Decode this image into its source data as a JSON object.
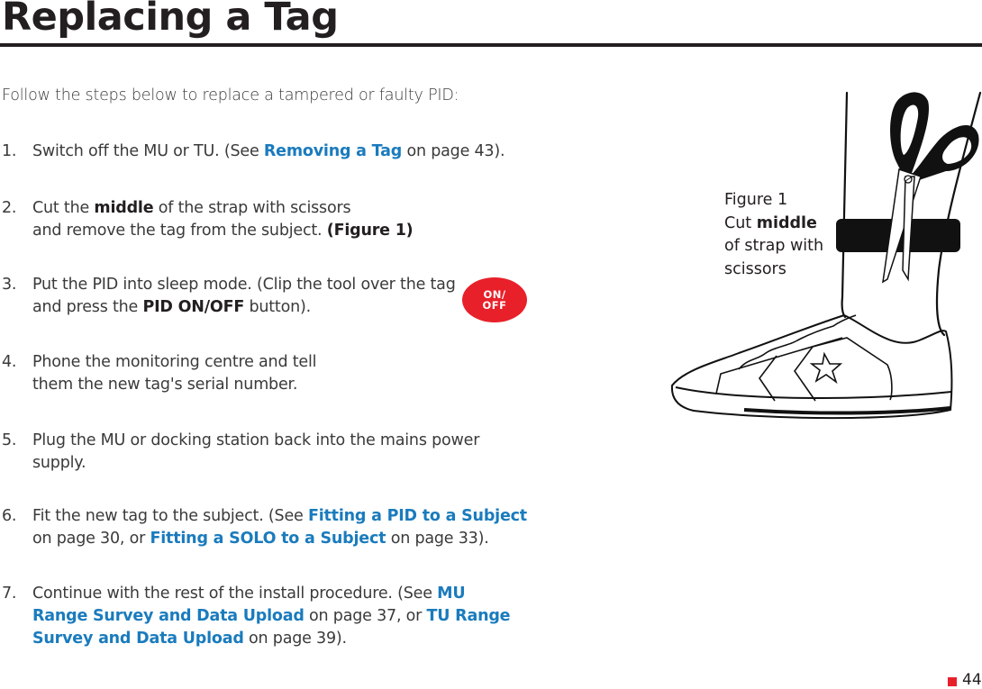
{
  "header": {
    "title": "Replacing a Tag"
  },
  "intro": "Follow the steps below to replace a tampered or faulty PID:",
  "steps": [
    {
      "num": "1.",
      "parts": [
        {
          "t": "Switch off the MU or TU. (See "
        },
        {
          "t": "Removing a Tag",
          "s": "link"
        },
        {
          "t": " on page 43)."
        }
      ]
    },
    {
      "num": "2.",
      "parts": [
        {
          "t": "Cut the "
        },
        {
          "t": "middle",
          "s": "b"
        },
        {
          "t": " of the strap with scissors"
        },
        {
          "br": true
        },
        {
          "t": "and remove the tag from the subject. "
        },
        {
          "t": "(Figure 1)",
          "s": "b"
        }
      ]
    },
    {
      "num": "3.",
      "parts": [
        {
          "t": "Put the PID into sleep mode. (Clip the tool over the tag"
        },
        {
          "br": true
        },
        {
          "t": "and press the "
        },
        {
          "t": "PID ON/OFF",
          "s": "b"
        },
        {
          "t": " button)."
        }
      ]
    },
    {
      "num": "4.",
      "parts": [
        {
          "t": "Phone the monitoring centre and tell"
        },
        {
          "br": true
        },
        {
          "t": "them the new tag's serial number."
        }
      ]
    },
    {
      "num": "5.",
      "parts": [
        {
          "t": "Plug the MU or docking station back into the mains power"
        },
        {
          "br": true
        },
        {
          "t": "supply."
        }
      ]
    },
    {
      "num": "6.",
      "parts": [
        {
          "t": "Fit the new tag to the subject. (See "
        },
        {
          "t": "Fitting a PID to a Subject",
          "s": "link"
        },
        {
          "br": true
        },
        {
          "t": "on page 30, or "
        },
        {
          "t": "Fitting a SOLO to a Subject",
          "s": "link"
        },
        {
          "t": " on page 33)."
        }
      ]
    },
    {
      "num": "7.",
      "parts": [
        {
          "t": "Continue with the rest of the install procedure. (See "
        },
        {
          "t": "MU",
          "s": "link"
        },
        {
          "br": true
        },
        {
          "t": "Range Survey and Data Upload",
          "s": "link"
        },
        {
          "t": " on page 37, or "
        },
        {
          "t": "TU Range",
          "s": "link"
        },
        {
          "br": true
        },
        {
          "t": "Survey and Data Upload",
          "s": "link"
        },
        {
          "t": " on page 39)."
        }
      ]
    }
  ],
  "onoff_button": {
    "line1": "ON/",
    "line2": "OFF",
    "color": "#e8202a"
  },
  "figure": {
    "caption_line1": "Figure 1",
    "caption_cut": "Cut ",
    "caption_bold": "middle",
    "caption_line3": "of strap with",
    "caption_line4": "scissors",
    "icon": "scissors-cutting-ankle-strap-illustration"
  },
  "footer": {
    "page_number": "44",
    "marker_color": "#e8202a"
  },
  "colors": {
    "link": "#1a7bbd",
    "text": "#3a3a3a",
    "heading": "#231f20"
  }
}
